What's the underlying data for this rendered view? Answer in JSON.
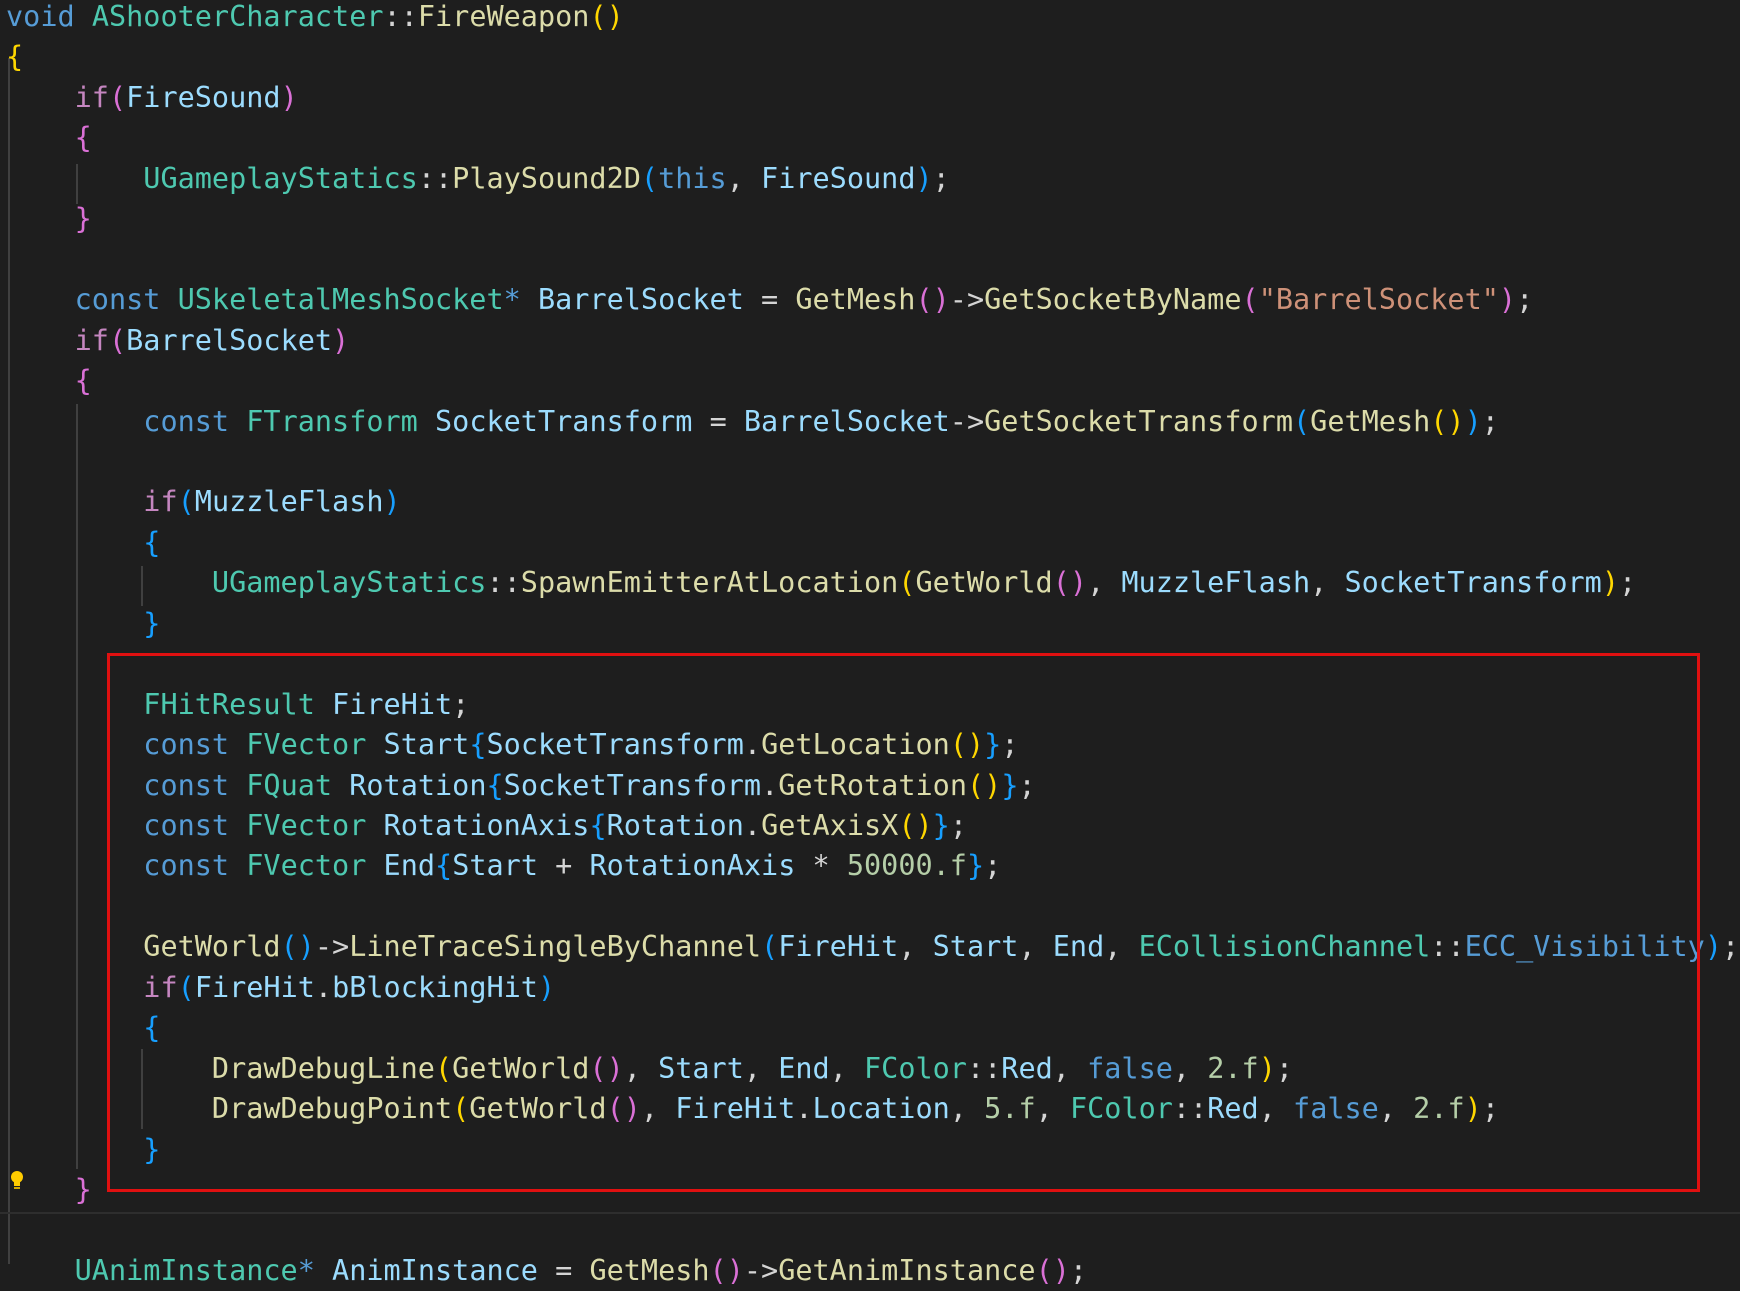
{
  "highlight_color": "#e01010",
  "icons": {
    "lightbulb": "lightbulb-icon"
  },
  "lines": [
    [
      [
        "kw",
        "void"
      ],
      [
        "p",
        " "
      ],
      [
        "type",
        "AShooterCharacter"
      ],
      [
        "p",
        "::"
      ],
      [
        "fn",
        "FireWeapon"
      ],
      [
        "b1",
        "()"
      ]
    ],
    [
      [
        "b1",
        "{"
      ]
    ],
    [
      [
        "p",
        "    "
      ],
      [
        "ctl",
        "if"
      ],
      [
        "b2",
        "("
      ],
      [
        "var",
        "FireSound"
      ],
      [
        "b2",
        ")"
      ]
    ],
    [
      [
        "p",
        "    "
      ],
      [
        "b2",
        "{"
      ]
    ],
    [
      [
        "p",
        "        "
      ],
      [
        "type",
        "UGameplayStatics"
      ],
      [
        "p",
        "::"
      ],
      [
        "fn",
        "PlaySound2D"
      ],
      [
        "b3",
        "("
      ],
      [
        "kw",
        "this"
      ],
      [
        "p",
        ", "
      ],
      [
        "var",
        "FireSound"
      ],
      [
        "b3",
        ")"
      ],
      [
        "p",
        ";"
      ]
    ],
    [
      [
        "p",
        "    "
      ],
      [
        "b2",
        "}"
      ]
    ],
    [],
    [
      [
        "p",
        "    "
      ],
      [
        "kw",
        "const"
      ],
      [
        "p",
        " "
      ],
      [
        "type",
        "USkeletalMeshSocket"
      ],
      [
        "kw",
        "*"
      ],
      [
        "p",
        " "
      ],
      [
        "var",
        "BarrelSocket"
      ],
      [
        "p",
        " = "
      ],
      [
        "fn",
        "GetMesh"
      ],
      [
        "b2",
        "()"
      ],
      [
        "p",
        "->"
      ],
      [
        "fn",
        "GetSocketByName"
      ],
      [
        "b2",
        "("
      ],
      [
        "str",
        "\"BarrelSocket\""
      ],
      [
        "b2",
        ")"
      ],
      [
        "p",
        ";"
      ]
    ],
    [
      [
        "p",
        "    "
      ],
      [
        "ctl",
        "if"
      ],
      [
        "b2",
        "("
      ],
      [
        "var",
        "BarrelSocket"
      ],
      [
        "b2",
        ")"
      ]
    ],
    [
      [
        "p",
        "    "
      ],
      [
        "b2",
        "{"
      ]
    ],
    [
      [
        "p",
        "        "
      ],
      [
        "kw",
        "const"
      ],
      [
        "p",
        " "
      ],
      [
        "type",
        "FTransform"
      ],
      [
        "p",
        " "
      ],
      [
        "var",
        "SocketTransform"
      ],
      [
        "p",
        " = "
      ],
      [
        "var",
        "BarrelSocket"
      ],
      [
        "p",
        "->"
      ],
      [
        "fn",
        "GetSocketTransform"
      ],
      [
        "b3",
        "("
      ],
      [
        "fn",
        "GetMesh"
      ],
      [
        "b1",
        "()"
      ],
      [
        "b3",
        ")"
      ],
      [
        "p",
        ";"
      ]
    ],
    [],
    [
      [
        "p",
        "        "
      ],
      [
        "ctl",
        "if"
      ],
      [
        "b3",
        "("
      ],
      [
        "var",
        "MuzzleFlash"
      ],
      [
        "b3",
        ")"
      ]
    ],
    [
      [
        "p",
        "        "
      ],
      [
        "b3",
        "{"
      ]
    ],
    [
      [
        "p",
        "            "
      ],
      [
        "type",
        "UGameplayStatics"
      ],
      [
        "p",
        "::"
      ],
      [
        "fn",
        "SpawnEmitterAtLocation"
      ],
      [
        "b1",
        "("
      ],
      [
        "fn",
        "GetWorld"
      ],
      [
        "b2",
        "()"
      ],
      [
        "p",
        ", "
      ],
      [
        "var",
        "MuzzleFlash"
      ],
      [
        "p",
        ", "
      ],
      [
        "var",
        "SocketTransform"
      ],
      [
        "b1",
        ")"
      ],
      [
        "p",
        ";"
      ]
    ],
    [
      [
        "p",
        "        "
      ],
      [
        "b3",
        "}"
      ]
    ],
    [],
    [
      [
        "p",
        "        "
      ],
      [
        "type",
        "FHitResult"
      ],
      [
        "p",
        " "
      ],
      [
        "var",
        "FireHit"
      ],
      [
        "p",
        ";"
      ]
    ],
    [
      [
        "p",
        "        "
      ],
      [
        "kw",
        "const"
      ],
      [
        "p",
        " "
      ],
      [
        "type",
        "FVector"
      ],
      [
        "p",
        " "
      ],
      [
        "var",
        "Start"
      ],
      [
        "b3",
        "{"
      ],
      [
        "var",
        "SocketTransform"
      ],
      [
        "p",
        "."
      ],
      [
        "fn",
        "GetLocation"
      ],
      [
        "b1",
        "()"
      ],
      [
        "b3",
        "}"
      ],
      [
        "p",
        ";"
      ]
    ],
    [
      [
        "p",
        "        "
      ],
      [
        "kw",
        "const"
      ],
      [
        "p",
        " "
      ],
      [
        "type",
        "FQuat"
      ],
      [
        "p",
        " "
      ],
      [
        "var",
        "Rotation"
      ],
      [
        "b3",
        "{"
      ],
      [
        "var",
        "SocketTransform"
      ],
      [
        "p",
        "."
      ],
      [
        "fn",
        "GetRotation"
      ],
      [
        "b1",
        "()"
      ],
      [
        "b3",
        "}"
      ],
      [
        "p",
        ";"
      ]
    ],
    [
      [
        "p",
        "        "
      ],
      [
        "kw",
        "const"
      ],
      [
        "p",
        " "
      ],
      [
        "type",
        "FVector"
      ],
      [
        "p",
        " "
      ],
      [
        "var",
        "RotationAxis"
      ],
      [
        "b3",
        "{"
      ],
      [
        "var",
        "Rotation"
      ],
      [
        "p",
        "."
      ],
      [
        "fn",
        "GetAxisX"
      ],
      [
        "b1",
        "()"
      ],
      [
        "b3",
        "}"
      ],
      [
        "p",
        ";"
      ]
    ],
    [
      [
        "p",
        "        "
      ],
      [
        "kw",
        "const"
      ],
      [
        "p",
        " "
      ],
      [
        "type",
        "FVector"
      ],
      [
        "p",
        " "
      ],
      [
        "var",
        "End"
      ],
      [
        "b3",
        "{"
      ],
      [
        "var",
        "Start"
      ],
      [
        "p",
        " + "
      ],
      [
        "var",
        "RotationAxis"
      ],
      [
        "p",
        " * "
      ],
      [
        "num",
        "50000.f"
      ],
      [
        "b3",
        "}"
      ],
      [
        "p",
        ";"
      ]
    ],
    [],
    [
      [
        "p",
        "        "
      ],
      [
        "fn",
        "GetWorld"
      ],
      [
        "b3",
        "()"
      ],
      [
        "p",
        "->"
      ],
      [
        "fn",
        "LineTraceSingleByChannel"
      ],
      [
        "b3",
        "("
      ],
      [
        "var",
        "FireHit"
      ],
      [
        "p",
        ", "
      ],
      [
        "var",
        "Start"
      ],
      [
        "p",
        ", "
      ],
      [
        "var",
        "End"
      ],
      [
        "p",
        ", "
      ],
      [
        "type",
        "ECollisionChannel"
      ],
      [
        "p",
        "::"
      ],
      [
        "kw",
        "ECC_Visibility"
      ],
      [
        "b3",
        ")"
      ],
      [
        "p",
        ";"
      ]
    ],
    [
      [
        "p",
        "        "
      ],
      [
        "ctl",
        "if"
      ],
      [
        "b3",
        "("
      ],
      [
        "var",
        "FireHit"
      ],
      [
        "p",
        "."
      ],
      [
        "var",
        "bBlockingHit"
      ],
      [
        "b3",
        ")"
      ]
    ],
    [
      [
        "p",
        "        "
      ],
      [
        "b3",
        "{"
      ]
    ],
    [
      [
        "p",
        "            "
      ],
      [
        "fn",
        "DrawDebugLine"
      ],
      [
        "b1",
        "("
      ],
      [
        "fn",
        "GetWorld"
      ],
      [
        "b2",
        "()"
      ],
      [
        "p",
        ", "
      ],
      [
        "var",
        "Start"
      ],
      [
        "p",
        ", "
      ],
      [
        "var",
        "End"
      ],
      [
        "p",
        ", "
      ],
      [
        "type",
        "FColor"
      ],
      [
        "p",
        "::"
      ],
      [
        "var",
        "Red"
      ],
      [
        "p",
        ", "
      ],
      [
        "kw",
        "false"
      ],
      [
        "p",
        ", "
      ],
      [
        "num",
        "2.f"
      ],
      [
        "b1",
        ")"
      ],
      [
        "p",
        ";"
      ]
    ],
    [
      [
        "p",
        "            "
      ],
      [
        "fn",
        "DrawDebugPoint"
      ],
      [
        "b1",
        "("
      ],
      [
        "fn",
        "GetWorld"
      ],
      [
        "b2",
        "()"
      ],
      [
        "p",
        ", "
      ],
      [
        "var",
        "FireHit"
      ],
      [
        "p",
        "."
      ],
      [
        "var",
        "Location"
      ],
      [
        "p",
        ", "
      ],
      [
        "num",
        "5.f"
      ],
      [
        "p",
        ", "
      ],
      [
        "type",
        "FColor"
      ],
      [
        "p",
        "::"
      ],
      [
        "var",
        "Red"
      ],
      [
        "p",
        ", "
      ],
      [
        "kw",
        "false"
      ],
      [
        "p",
        ", "
      ],
      [
        "num",
        "2.f"
      ],
      [
        "b1",
        ")"
      ],
      [
        "p",
        ";"
      ]
    ],
    [
      [
        "p",
        "        "
      ],
      [
        "b3",
        "}"
      ]
    ],
    [
      [
        "p",
        "    "
      ],
      [
        "b2",
        "}"
      ]
    ],
    [],
    [
      [
        "p",
        "    "
      ],
      [
        "type",
        "UAnimInstance"
      ],
      [
        "kw",
        "*"
      ],
      [
        "p",
        " "
      ],
      [
        "var",
        "AnimInstance"
      ],
      [
        "p",
        " = "
      ],
      [
        "fn",
        "GetMesh"
      ],
      [
        "b2",
        "()"
      ],
      [
        "p",
        "->"
      ],
      [
        "fn",
        "GetAnimInstance"
      ],
      [
        "b2",
        "()"
      ],
      [
        "p",
        ";"
      ]
    ]
  ]
}
